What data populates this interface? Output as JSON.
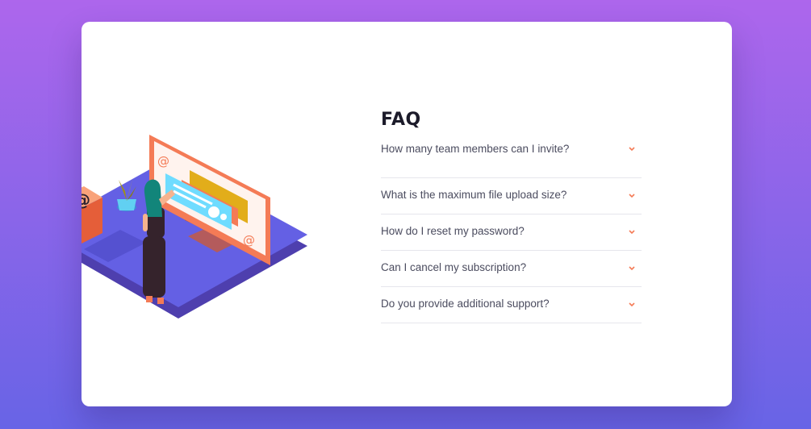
{
  "faq": {
    "title": "FAQ",
    "items": [
      {
        "question": "How many team members can I invite?"
      },
      {
        "question": "What is the maximum file upload size?"
      },
      {
        "question": "How do I reset my password?"
      },
      {
        "question": "Can I cancel my subscription?"
      },
      {
        "question": "Do you provide additional support?"
      }
    ]
  },
  "colors": {
    "background_top": "#ad66ec",
    "background_bottom": "#6864e6",
    "accent": "#f47b56",
    "title": "#1c1b2a",
    "question": "#4b4c5f",
    "divider": "#e6e6ec"
  },
  "icons": [
    "illustration",
    "chevron-down-icon"
  ]
}
